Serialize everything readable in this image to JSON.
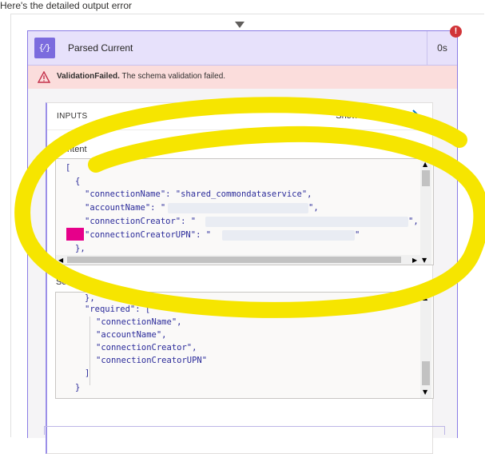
{
  "intro_text": "Here's the detailed output error",
  "action": {
    "title": "Parsed Current",
    "duration": "0s",
    "icon": "braces-action-icon",
    "accent_color": "#7b6bde",
    "error_badge": "!"
  },
  "error": {
    "code": "ValidationFailed.",
    "message": "The schema validation failed.",
    "icon": "warning-icon"
  },
  "inputs": {
    "title": "INPUTS",
    "show_raw_label": "Show raw inputs",
    "content_label": "Content",
    "schema_label": "Schema",
    "content_lines": {
      "l0": "[",
      "l1": "{",
      "l2": "\"connectionName\": \"shared_commondataservice\",",
      "l3": "\"accountName\": \"",
      "l3_end": "\",",
      "l4": "\"connectionCreator\": \"",
      "l4_end": "\",",
      "l5": "\"connectionCreatorUPN\": \"",
      "l5_end": "\"",
      "l6": "},"
    },
    "schema_lines": {
      "s0": "},",
      "s1": "\"required\": [",
      "s2": "\"connectionName\",",
      "s3": "\"accountName\",",
      "s4": "\"connectionCreator\",",
      "s5": "\"connectionCreatorUPN\"",
      "s6": "]",
      "s7": "}"
    }
  }
}
